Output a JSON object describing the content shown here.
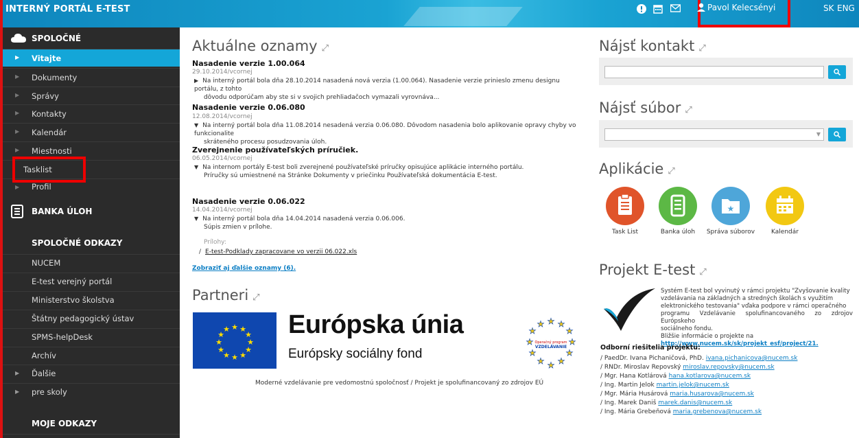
{
  "topbar": {
    "title": "INTERNÝ PORTÁL E-TEST",
    "user": "Pavol Kelecsényi",
    "lang_sk": "SK",
    "lang_en": "ENG",
    "icons": [
      "alert-icon",
      "calendar-icon",
      "mail-icon",
      "user-icon"
    ]
  },
  "sidebar": {
    "section_common": "SPOLOČNÉ",
    "items": [
      {
        "label": "Vitajte"
      },
      {
        "label": "Dokumenty"
      },
      {
        "label": "Správy"
      },
      {
        "label": "Kontakty"
      },
      {
        "label": "Kalendár"
      },
      {
        "label": "Miestnosti"
      },
      {
        "label": "Tasklist"
      },
      {
        "label": "Profil"
      }
    ],
    "section_bank": "BANKA ÚLOH",
    "section_links": "SPOLOČNÉ ODKAZY",
    "links": [
      {
        "label": "NUCEM"
      },
      {
        "label": "E-test verejný portál"
      },
      {
        "label": "Ministerstvo školstva"
      },
      {
        "label": "Štátny pedagogický ústav"
      },
      {
        "label": "SPMS-helpDesk"
      },
      {
        "label": "Archív"
      },
      {
        "label": "Ďalšie"
      },
      {
        "label": "pre skoly"
      }
    ],
    "section_my": "MOJE ODKAZY"
  },
  "main": {
    "news_title": "Aktuálne oznamy",
    "news": [
      {
        "title": "Nasadenie verzie 1.00.064",
        "date": "29.10.2014/vcornej",
        "line1": "Na interný portál bola dňa 28.10.2014 nasadená nová verzia (1.00.064). Nasadenie verzie prinieslo zmenu designu portálu, z tohto",
        "line2": "dôvodu odporúčam aby ste si v svojich prehliadačoch vymazali vyrovnáva..."
      },
      {
        "title": "Nasadenie verzie 0.06.080",
        "date": "12.08.2014/vcornej",
        "line1": "Na interný portál bola dňa 11.08.2014 nesadená verzia 0.06.080. Dôvodom nasadenia bolo aplikovanie opravy chyby vo funkcionalite",
        "line2": "skráteného procesu posudzovania úloh."
      },
      {
        "title": "Zverejnenie používateľských príručiek.",
        "date": "06.05.2014/vcornej",
        "line1": "Na internom portály E-test boli zverejnené používateľské príručky opisujúce aplikácie interného portálu.",
        "line2": "Príručky sú umiestnené na Stránke Dokumenty v priečinku Používateľská dokumentácia E-test."
      },
      {
        "title": "Nasadenie verzie 0.06.022",
        "date": "14.04.2014/vcornej",
        "line1": "Na interný portál bola dňa 14.04.2014 nasadená verzia 0.06.006.",
        "line2": "Súpis zmien v prílohe."
      }
    ],
    "attachments_label": "Prílohy:",
    "attachment": "E-test-Podklady zapracovane vo verzii 06.022.xls",
    "more_link": "Zobraziť aj ďalšie oznamy (6).",
    "partners_title": "Partneri",
    "eu_big": "Európska únia",
    "eu_small": "Európsky sociálny fond",
    "op_label1": "Operačný program",
    "op_label2": "VZDELÁVANIE",
    "partners_caption": "Moderné vzdelávanie pre vedomostnú spoločnosť / Projekt je spolufinancovaný zo zdrojov EÚ"
  },
  "right": {
    "find_contact": "Nájsť kontakt",
    "find_file": "Nájsť súbor",
    "apps_title": "Aplikácie",
    "apps": [
      {
        "label": "Task List",
        "color": "#e0542a"
      },
      {
        "label": "Banka úloh",
        "color": "#5cb845"
      },
      {
        "label": "Správa súborov",
        "color": "#4ea6d9"
      },
      {
        "label": "Kalendár",
        "color": "#f2c812"
      }
    ],
    "project_title": "Projekt E-test",
    "project_text1": "Systém E-test bol vyvinutý v rámci projektu \"Zvyšovanie kvality",
    "project_text2": "vzdelávania na základných a stredných školách s využitím",
    "project_text3": "elektronického testovania\" vďaka podpore v rámci operačného",
    "project_text4": "programu Vzdelávanie spolufinancovaného zo zdrojov Európskeho",
    "project_text5": "sociálneho fondu.",
    "project_text6": "Bližšie informácie o projekte na",
    "project_link": "http://www.nucem.sk/sk/projekt_esf/project/21.",
    "team_title": "Odborní riešitelia projektu:",
    "team": [
      {
        "name": "PaedDr. Ivana Pichaničová, PhD.",
        "email": "ivana.pichanicova@nucem.sk"
      },
      {
        "name": "RNDr. Miroslav Repovský",
        "email": "miroslav.repovsky@nucem.sk"
      },
      {
        "name": "Mgr. Hana Kotlárová",
        "email": "hana.kotlarova@nucem.sk"
      },
      {
        "name": "Ing. Martin Jelok",
        "email": "martin.jelok@nucem.sk"
      },
      {
        "name": "Mgr. Mária Husárová",
        "email": "maria.husarova@nucem.sk"
      },
      {
        "name": "Ing. Marek Daniš",
        "email": "marek.danis@nucem.sk"
      },
      {
        "name": "Ing. Mária Grebeňová",
        "email": "maria.grebenova@nucem.sk"
      }
    ]
  }
}
